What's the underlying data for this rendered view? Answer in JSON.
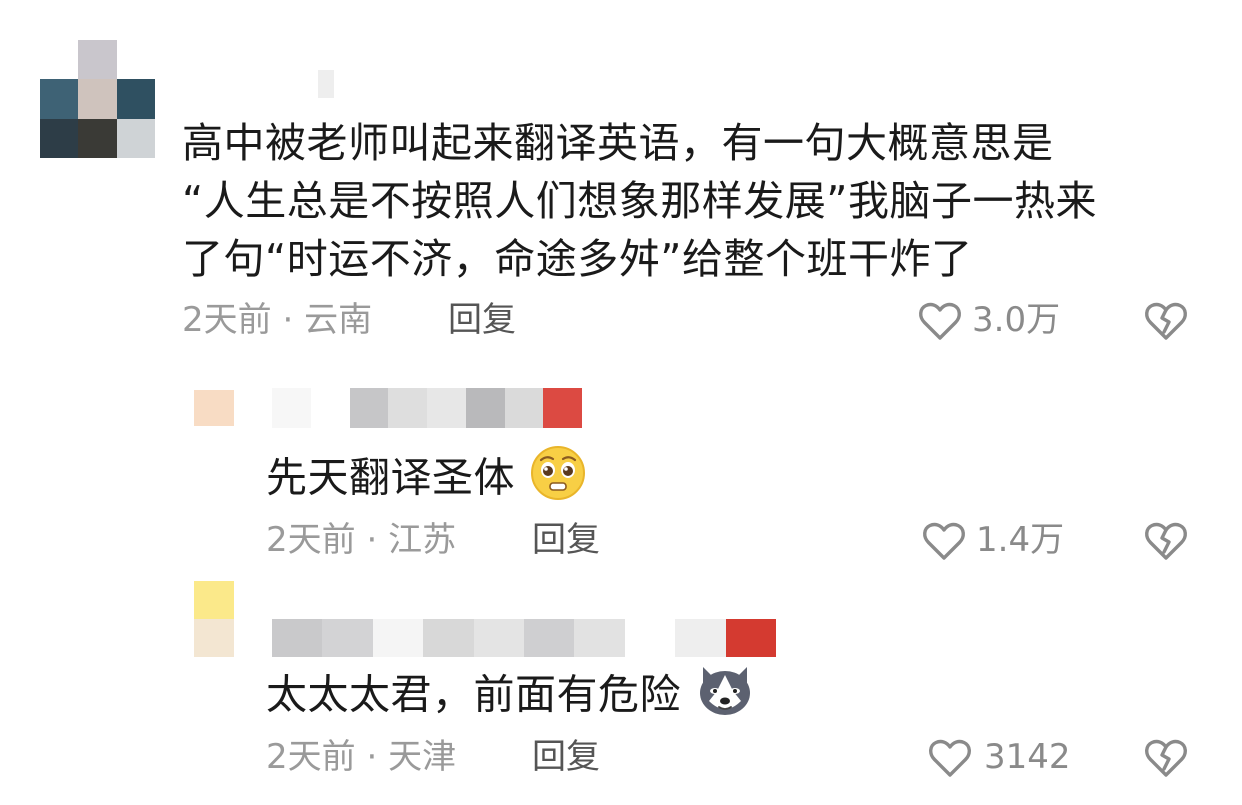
{
  "comments": [
    {
      "text": "高中被老师叫起来翻译英语，有一句大概意思是“人生总是不按照人们想象那样发展”我脑子一热来了句“时运不济，命途多舛”给整个班干炸了",
      "line1": "高中被老师叫起来翻译英语，有一句大概意思是",
      "line2": "“人生总是不按照人们想象那样发展”我脑子一热来",
      "line3": "了句“时运不济，命途多舛”给整个班干炸了",
      "time": "2天前",
      "location": "云南",
      "reply_label": "回复",
      "like_count": "3.0万"
    },
    {
      "text": "先天翻译圣体",
      "emoji": "pleading-face",
      "time": "2天前",
      "location": "江苏",
      "reply_label": "回复",
      "like_count": "1.4万"
    },
    {
      "text": "太太太君，前面有危险",
      "emoji": "husky-dog",
      "time": "2天前",
      "location": "天津",
      "reply_label": "回复",
      "like_count": "3142"
    }
  ],
  "separator": " · ",
  "colors": {
    "text": "#1a1a1a",
    "meta": "#9a9a9a",
    "icon": "#8a8a8a"
  }
}
